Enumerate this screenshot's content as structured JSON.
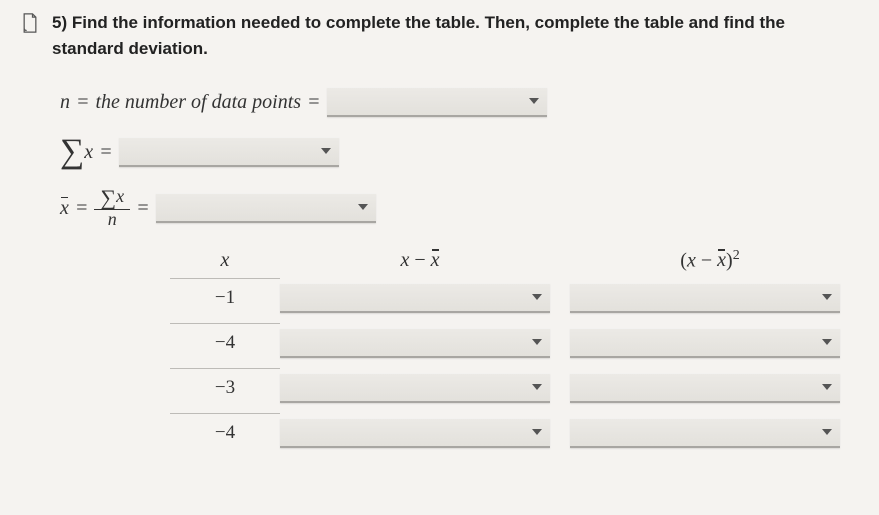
{
  "question": {
    "number": "5)",
    "text": "Find the information needed to complete the table. Then, complete the table and find the standard deviation."
  },
  "lines": {
    "n_lhs": "n",
    "n_desc": "the number of data points",
    "eq": "="
  },
  "table": {
    "headers": {
      "x": "x",
      "diff_l": "x",
      "diff_r": "x",
      "sq_l": "x",
      "sq_r": "x"
    },
    "rows": [
      {
        "x": "−1"
      },
      {
        "x": "−4"
      },
      {
        "x": "−3"
      },
      {
        "x": "−4"
      }
    ]
  },
  "chart_data": {
    "type": "table",
    "title": "Standard deviation worksheet",
    "columns": [
      "x",
      "x − x̄",
      "(x − x̄)²"
    ],
    "x_values": [
      -1,
      -4,
      -3,
      -4
    ],
    "inputs": {
      "n": null,
      "sum_x": null,
      "mean": null,
      "deviations": [
        null,
        null,
        null,
        null
      ],
      "squared_deviations": [
        null,
        null,
        null,
        null
      ]
    }
  }
}
